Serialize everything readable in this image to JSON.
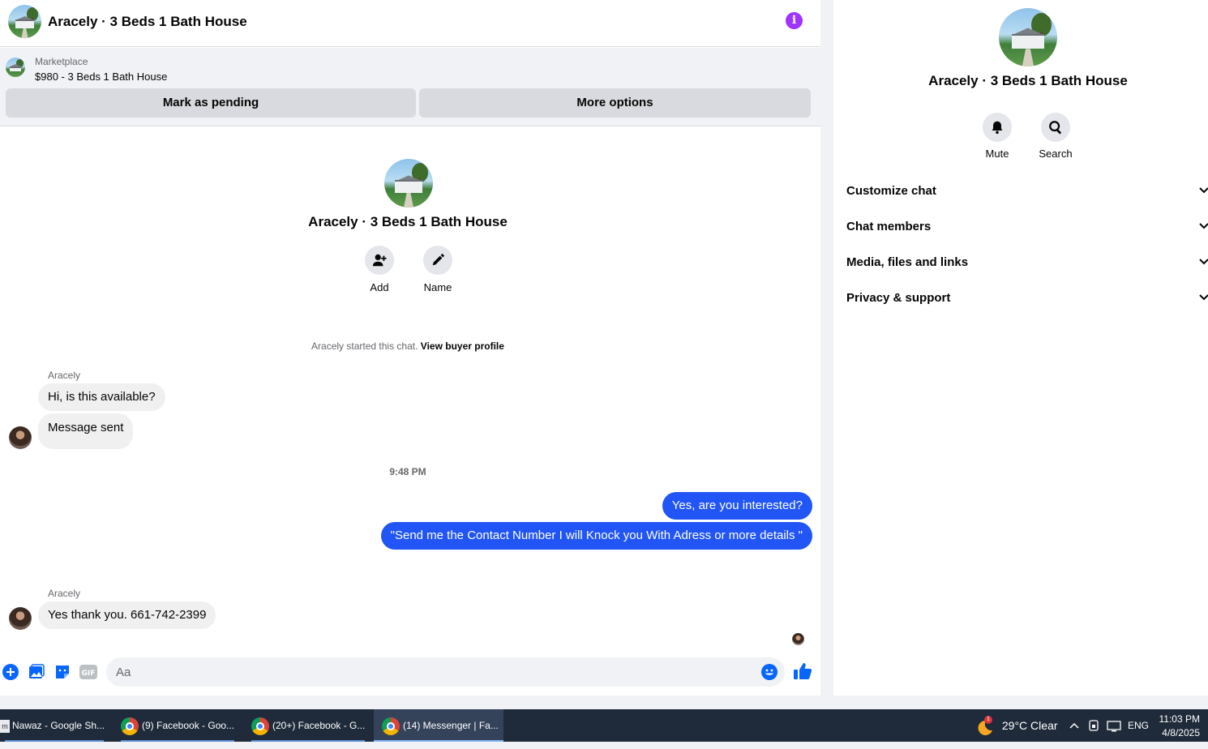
{
  "header": {
    "title": "Aracely · 3 Beds 1 Bath House"
  },
  "marketplace": {
    "label": "Marketplace",
    "item": "$980 - 3 Beds 1 Bath House",
    "mark_pending": "Mark as pending",
    "more_options": "More options"
  },
  "intro": {
    "title": "Aracely · 3 Beds 1 Bath House",
    "add_label": "Add",
    "name_label": "Name",
    "started_text": "Aracely started this chat.",
    "view_profile": "View buyer profile"
  },
  "messages": {
    "sender1": "Aracely",
    "msg1": "Hi, is this available?",
    "msg2": "Message sent",
    "time": "9:48 PM",
    "out1": "Yes, are you interested?",
    "out2": "\"Send me the Contact Number I will Knock you With Adress or more details \"",
    "sender2": "Aracely",
    "msg3": "Yes thank you. 661-742-2399"
  },
  "composer": {
    "placeholder": "Aa"
  },
  "info_panel": {
    "name": "Aracely · 3 Beds 1 Bath House",
    "mute": "Mute",
    "search": "Search",
    "sections": [
      "Customize chat",
      "Chat members",
      "Media, files and links",
      "Privacy & support"
    ]
  },
  "taskbar": {
    "tasks": [
      "Nawaz - Google Sh...",
      "(9) Facebook - Goo...",
      "(20+) Facebook - G...",
      "(14) Messenger | Fa..."
    ],
    "weather": "29°C  Clear",
    "weather_badge": "1",
    "lang": "ENG",
    "time": "11:03 PM",
    "date": "4/8/2025"
  },
  "colors": {
    "accent": "#2155f6",
    "info": "#a033ff",
    "messenger_blue": "#0866ff"
  }
}
